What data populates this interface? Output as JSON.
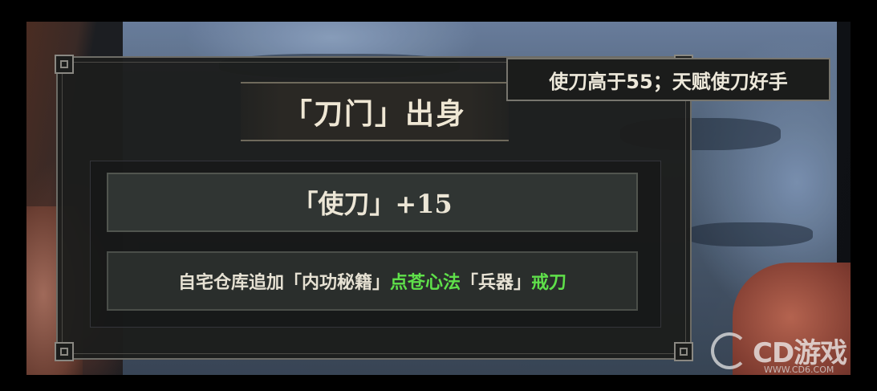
{
  "tooltip": {
    "text": "使刀高于55；天赋使刀好手"
  },
  "panel": {
    "title": "「刀门」出身",
    "stat_bonus": "「使刀」+15",
    "warehouse_bonus": {
      "prefix": "自宅仓库追加「内功秘籍」",
      "item1": "点苍心法",
      "middle": "「兵器」",
      "item2": "戒刀"
    }
  },
  "watermark": {
    "brand": "CD游戏",
    "url": "WWW.CD6.COM"
  },
  "colors": {
    "highlight_green": "#5fe04a",
    "text_cream": "#efe7d4",
    "panel_bg": "#1c1d1c",
    "border_grey": "#6d6c66"
  }
}
